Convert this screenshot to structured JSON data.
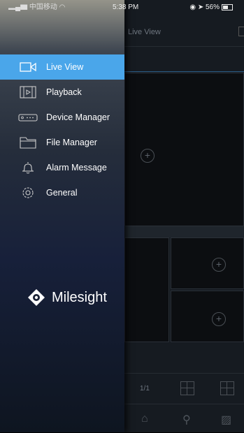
{
  "statusbar": {
    "carrier": "中国移动",
    "time": "5:38 PM",
    "battery": "56%"
  },
  "main": {
    "title": "Live View",
    "page_indicator": "1/1",
    "grid_options": [
      "4",
      "16"
    ]
  },
  "drawer": {
    "items": [
      {
        "label": "Live View",
        "icon": "live-view-icon",
        "active": true
      },
      {
        "label": "Playback",
        "icon": "playback-icon",
        "active": false
      },
      {
        "label": "Device Manager",
        "icon": "device-manager-icon",
        "active": false
      },
      {
        "label": "File Manager",
        "icon": "folder-icon",
        "active": false
      },
      {
        "label": "Alarm Message",
        "icon": "bell-icon",
        "active": false
      },
      {
        "label": "General",
        "icon": "gear-icon",
        "active": false
      }
    ],
    "brand": "Milesight"
  },
  "colors": {
    "accent": "#4aa6ea",
    "main_bg": "#161b21"
  }
}
